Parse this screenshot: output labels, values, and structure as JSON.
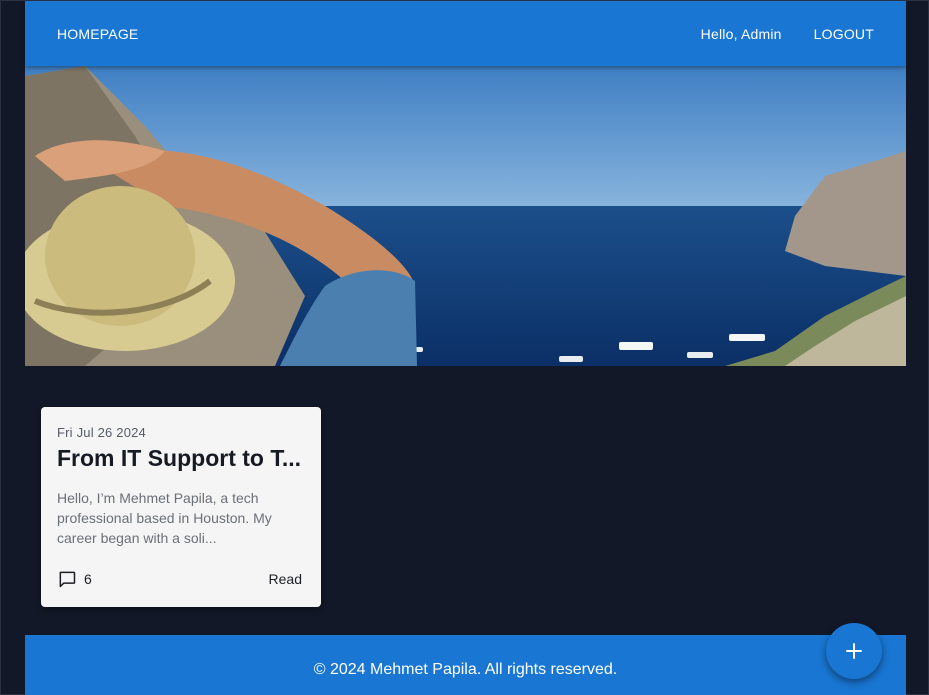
{
  "navbar": {
    "home_label": "HOMEPAGE",
    "greeting": "Hello, Admin",
    "logout_label": "LOGOUT"
  },
  "hero": {
    "image": "coastal-bay-photo"
  },
  "posts": [
    {
      "date": "Fri Jul 26 2024",
      "title": "From IT Support to T...",
      "excerpt": "Hello, I’m Mehmet Papila, a tech professional based in Houston. My career began with a soli...",
      "comment_icon": "comment-icon",
      "comment_count": "6",
      "read_label": "Read"
    }
  ],
  "footer": {
    "text": "© 2024 Mehmet Papila. All rights reserved."
  },
  "fab": {
    "icon": "plus-icon"
  },
  "colors": {
    "background": "#121827",
    "primary": "#1976d2",
    "card": "#f5f5f5"
  }
}
